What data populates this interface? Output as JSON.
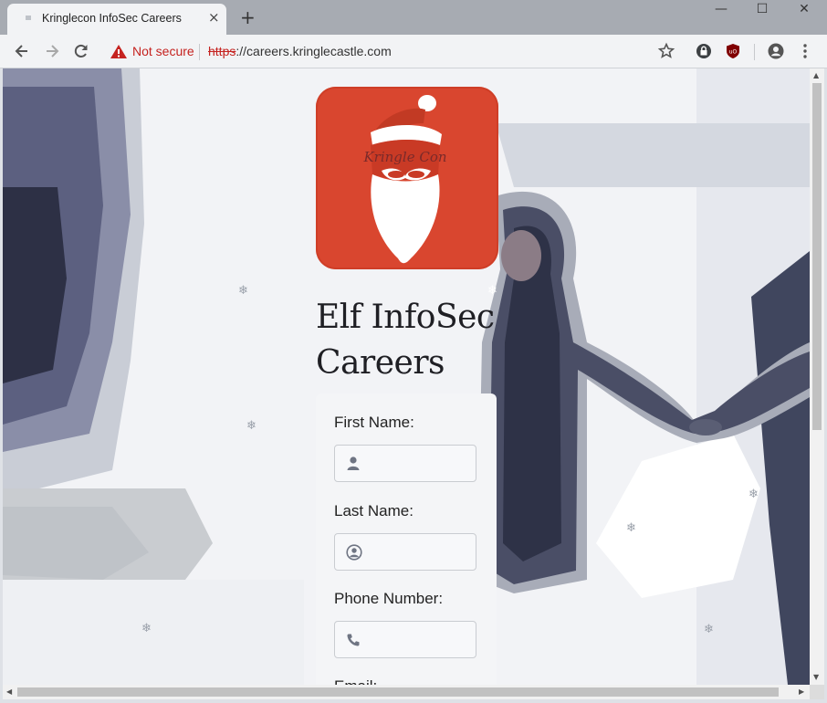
{
  "browser": {
    "tab_title": "Kringlecon InfoSec Careers",
    "tab_close_glyph": "×",
    "new_tab_glyph": "+",
    "security_label": "Not secure",
    "url_scheme": "https",
    "url_rest": "://careers.kringlecastle.com",
    "icons": [
      "back-arrow-icon",
      "forward-arrow-icon",
      "reload-icon",
      "warning-icon",
      "star-icon",
      "lock-extension-icon",
      "ublock-icon",
      "account-icon",
      "menu-kebab-icon"
    ]
  },
  "window_controls": {
    "minimize": "—",
    "maximize": "☐",
    "close": "✕"
  },
  "page": {
    "logo_text": "Kringle Con",
    "heading_line1": "Elf InfoSec",
    "heading_line2": "Careers",
    "snowflake_glyph": "❄",
    "form": {
      "first_name_label": "First Name:",
      "last_name_label": "Last Name:",
      "phone_label": "Phone Number:",
      "email_label": "Email:"
    }
  },
  "colors": {
    "logo_red": "#d9462f",
    "warning_red": "#c5221f",
    "heading_text": "#1f1f24"
  }
}
